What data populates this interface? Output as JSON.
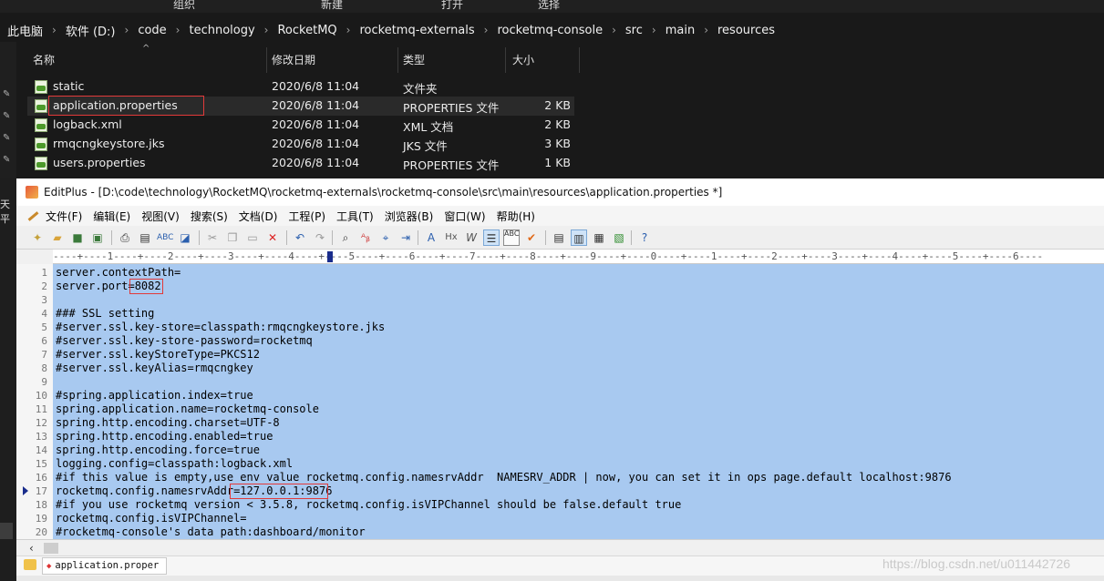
{
  "ribbon": {
    "items": [
      "组织",
      "新建",
      "打开",
      "选择"
    ]
  },
  "breadcrumb": [
    "此电脑",
    "软件 (D:)",
    "code",
    "technology",
    "RocketMQ",
    "rocketmq-externals",
    "rocketmq-console",
    "src",
    "main",
    "resources"
  ],
  "columns": {
    "name": "名称",
    "modified": "修改日期",
    "type": "类型",
    "size": "大小"
  },
  "files": [
    {
      "name": "static",
      "date": "2020/6/8 11:04",
      "type": "文件夹",
      "size": ""
    },
    {
      "name": "application.properties",
      "date": "2020/6/8 11:04",
      "type": "PROPERTIES 文件",
      "size": "2 KB"
    },
    {
      "name": "logback.xml",
      "date": "2020/6/8 11:04",
      "type": "XML 文档",
      "size": "2 KB"
    },
    {
      "name": "rmqcngkeystore.jks",
      "date": "2020/6/8 11:04",
      "type": "JKS 文件",
      "size": "3 KB"
    },
    {
      "name": "users.properties",
      "date": "2020/6/8 11:04",
      "type": "PROPERTIES 文件",
      "size": "1 KB"
    }
  ],
  "left_edge_label": "天平",
  "editor": {
    "title": "EditPlus - [D:\\code\\technology\\RocketMQ\\rocketmq-externals\\rocketmq-console\\src\\main\\resources\\application.properties *]",
    "menu": [
      "文件(F)",
      "编辑(E)",
      "视图(V)",
      "搜索(S)",
      "文档(D)",
      "工程(P)",
      "工具(T)",
      "浏览器(B)",
      "窗口(W)",
      "帮助(H)"
    ],
    "ruler": "----+----1----+----2----+----3----+----4----+----5----+----6----+----7----+----8----+----9----+----0----+----1----+----2----+----3----+----4----+----5----+----6----",
    "lines": [
      "server.contextPath=",
      "server.port=8082",
      "",
      "### SSL setting",
      "#server.ssl.key-store=classpath:rmqcngkeystore.jks",
      "#server.ssl.key-store-password=rocketmq",
      "#server.ssl.keyStoreType=PKCS12",
      "#server.ssl.keyAlias=rmqcngkey",
      "",
      "#spring.application.index=true",
      "spring.application.name=rocketmq-console",
      "spring.http.encoding.charset=UTF-8",
      "spring.http.encoding.enabled=true",
      "spring.http.encoding.force=true",
      "logging.config=classpath:logback.xml",
      "#if this value is empty,use env value rocketmq.config.namesrvAddr  NAMESRV_ADDR | now, you can set it in ops page.default localhost:9876",
      "rocketmq.config.namesrvAddr=127.0.0.1:9876",
      "#if you use rocketmq version < 3.5.8, rocketmq.config.isVIPChannel should be false.default true",
      "rocketmq.config.isVIPChannel=",
      "#rocketmq-console's data path:dashboard/monitor"
    ],
    "line_numbers": [
      "1",
      "2",
      "3",
      "4",
      "5",
      "6",
      "7",
      "8",
      "9",
      "10",
      "11",
      "12",
      "13",
      "14",
      "15",
      "16",
      "17",
      "18",
      "19",
      "20"
    ],
    "tab_label": "application.proper"
  },
  "watermark": "https://blog.csdn.net/u011442726",
  "colors": {
    "selection": "#a8c9f0",
    "highlight_box": "#e23a3a",
    "explorer_bg": "#191919"
  }
}
